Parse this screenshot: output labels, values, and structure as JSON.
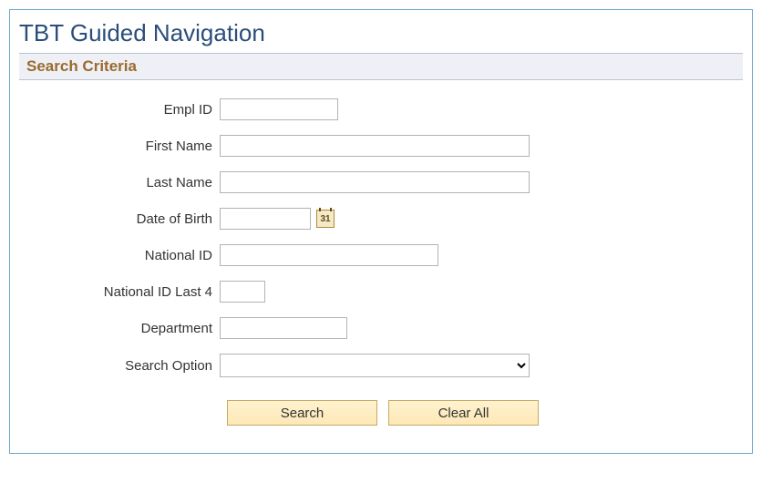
{
  "page_title": "TBT Guided Navigation",
  "section_title": "Search Criteria",
  "fields": {
    "empl_id": {
      "label": "Empl ID",
      "value": ""
    },
    "first_name": {
      "label": "First Name",
      "value": ""
    },
    "last_name": {
      "label": "Last Name",
      "value": ""
    },
    "dob": {
      "label": "Date of Birth",
      "value": ""
    },
    "national_id": {
      "label": "National ID",
      "value": ""
    },
    "nid_last4": {
      "label": "National ID Last 4",
      "value": ""
    },
    "department": {
      "label": "Department",
      "value": ""
    },
    "search_option": {
      "label": "Search Option",
      "value": ""
    }
  },
  "calendar_day": "31",
  "buttons": {
    "search": "Search",
    "clear_all": "Clear All"
  }
}
